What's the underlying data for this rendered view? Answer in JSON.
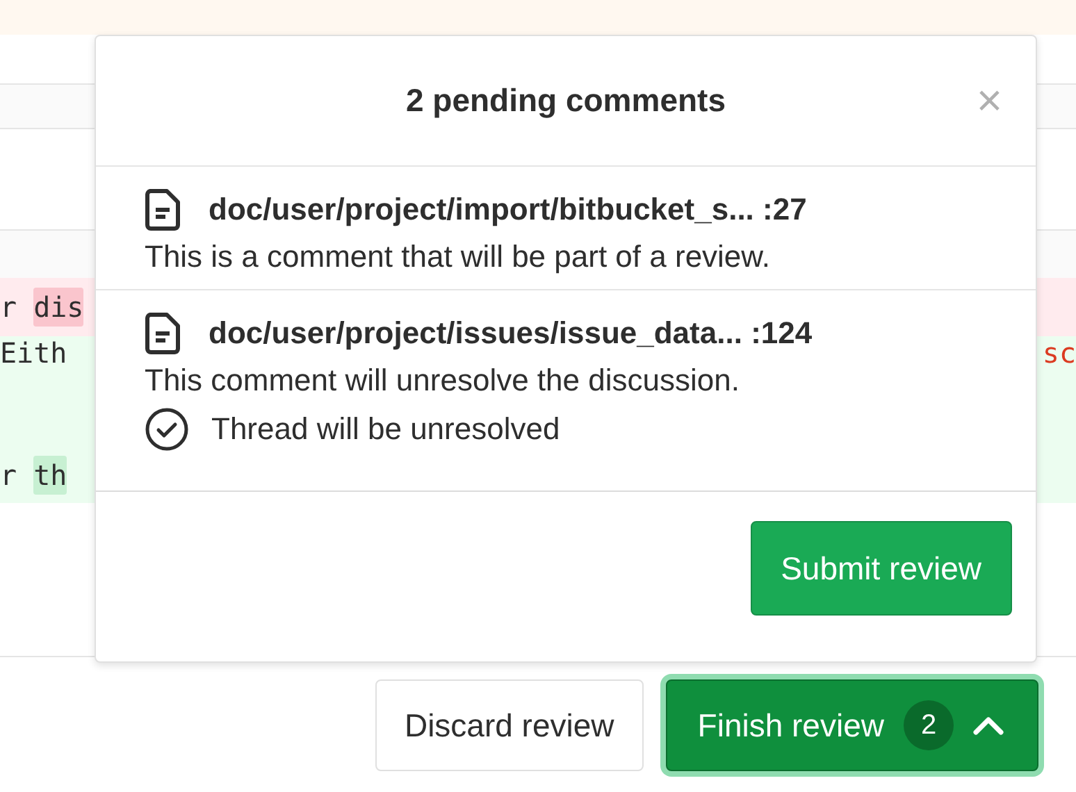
{
  "diff_lines": [
    {
      "kind": "removed",
      "segments": [
        {
          "text": "r ",
          "highlight": false
        },
        {
          "text": "dis",
          "highlight": true
        }
      ]
    },
    {
      "kind": "added",
      "segments": [
        {
          "text": "Eith",
          "highlight": false
        }
      ],
      "right_text": "sc"
    },
    {
      "kind": "added"
    },
    {
      "kind": "added",
      "segments": [
        {
          "text": "r ",
          "highlight": false
        },
        {
          "text": "th",
          "highlight": true
        }
      ]
    }
  ],
  "popup": {
    "title": "2 pending comments",
    "close": "×",
    "comments": [
      {
        "file": "doc/user/project/import/bitbucket_s...",
        "line": ":27",
        "text": "This is a comment that will be part of a review."
      },
      {
        "file": "doc/user/project/issues/issue_data...",
        "line": ":124",
        "text": "This comment will unresolve the discussion.",
        "resolution": "Thread will be unresolved"
      }
    ],
    "submit_button": "Submit review"
  },
  "footer": {
    "discard_button": "Discard review",
    "finish_button": {
      "label": "Finish review",
      "count": "2",
      "expanded": true
    }
  }
}
